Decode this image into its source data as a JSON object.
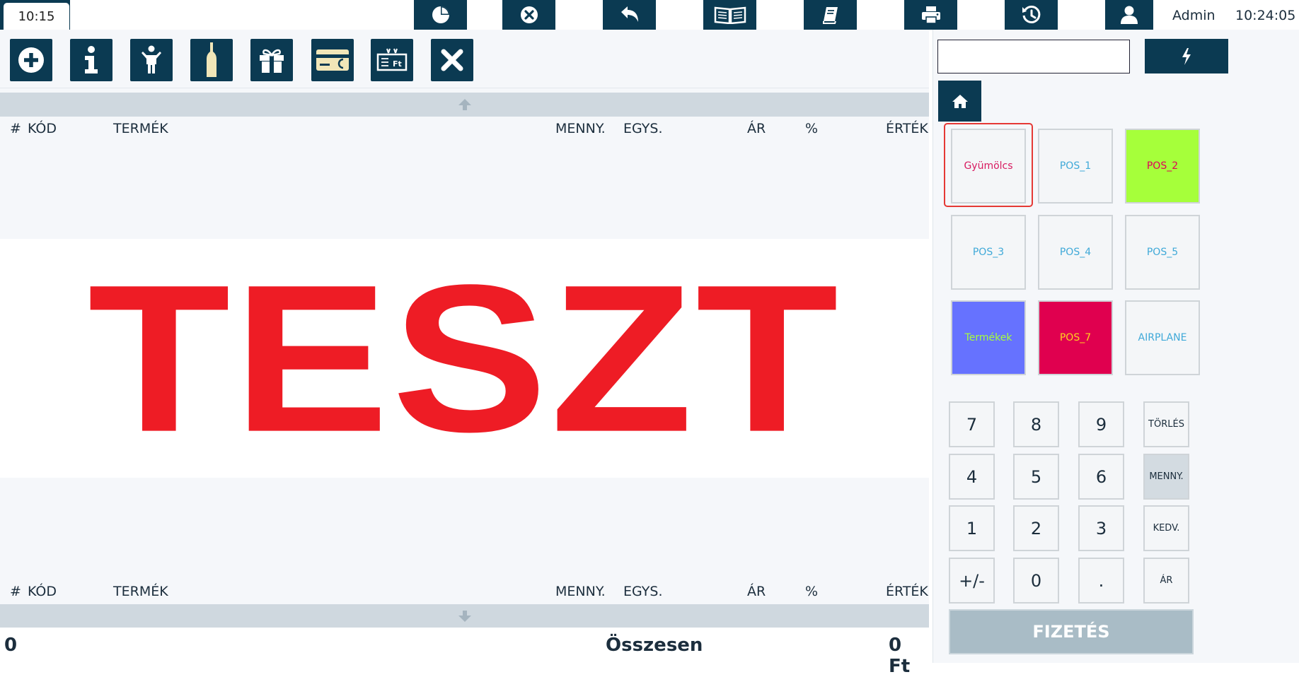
{
  "topbar": {
    "clock_left": "10:15",
    "user_name": "Admin",
    "clock_right": "10:24:05",
    "icons": [
      "pie-chart-icon",
      "close-circle-icon",
      "undo-icon",
      "open-book-icon",
      "book-icon",
      "printer-icon",
      "history-icon",
      "user-icon"
    ]
  },
  "toolbar": {
    "icons": [
      "plus-circle-icon",
      "info-icon",
      "person-icon",
      "bottle-icon",
      "gift-icon",
      "card-icon",
      "price-tag-icon",
      "close-icon"
    ]
  },
  "table": {
    "headers": {
      "num": "#",
      "code": "KÓD",
      "product": "TERMÉK",
      "qty": "MENNY.",
      "unit": "EGYS.",
      "price": "ÁR",
      "percent": "%",
      "value": "ÉRTÉK"
    }
  },
  "banner": {
    "text": "TESZT"
  },
  "totals": {
    "count": "0",
    "label": "Összesen",
    "amount": "0 Ft"
  },
  "right": {
    "search": {
      "value": "",
      "placeholder": ""
    },
    "categories": [
      {
        "label": "Gyümölcs",
        "bg": "#f4f6f8",
        "fg": "#d81b60"
      },
      {
        "label": "POS_1",
        "bg": "#f4f6f8",
        "fg": "#3fa9d8"
      },
      {
        "label": "POS_2",
        "bg": "#a6ff3a",
        "fg": "#e0005a"
      },
      {
        "label": "POS_3",
        "bg": "#f4f6f8",
        "fg": "#3fa9d8"
      },
      {
        "label": "POS_4",
        "bg": "#f4f6f8",
        "fg": "#3fa9d8"
      },
      {
        "label": "POS_5",
        "bg": "#f4f6f8",
        "fg": "#3fa9d8"
      },
      {
        "label": "Termékek",
        "bg": "#6672ff",
        "fg": "#a6ff3a"
      },
      {
        "label": "POS_7",
        "bg": "#e0004f",
        "fg": "#ffd21f"
      },
      {
        "label": "AIRPLANE",
        "bg": "#f4f6f8",
        "fg": "#3fa9d8"
      }
    ],
    "keypad": {
      "k7": "7",
      "k8": "8",
      "k9": "9",
      "del": "TÖRLÉS",
      "k4": "4",
      "k5": "5",
      "k6": "6",
      "qty": "MENNY.",
      "k1": "1",
      "k2": "2",
      "k3": "3",
      "disc": "KEDV.",
      "sign": "+/-",
      "k0": "0",
      "dot": ".",
      "price": "ÁR"
    },
    "pay_label": "FIZETÉS"
  },
  "colors": {
    "primary": "#0b3a52",
    "banner_red": "#ee1c25",
    "selected_ring": "#e53935"
  }
}
